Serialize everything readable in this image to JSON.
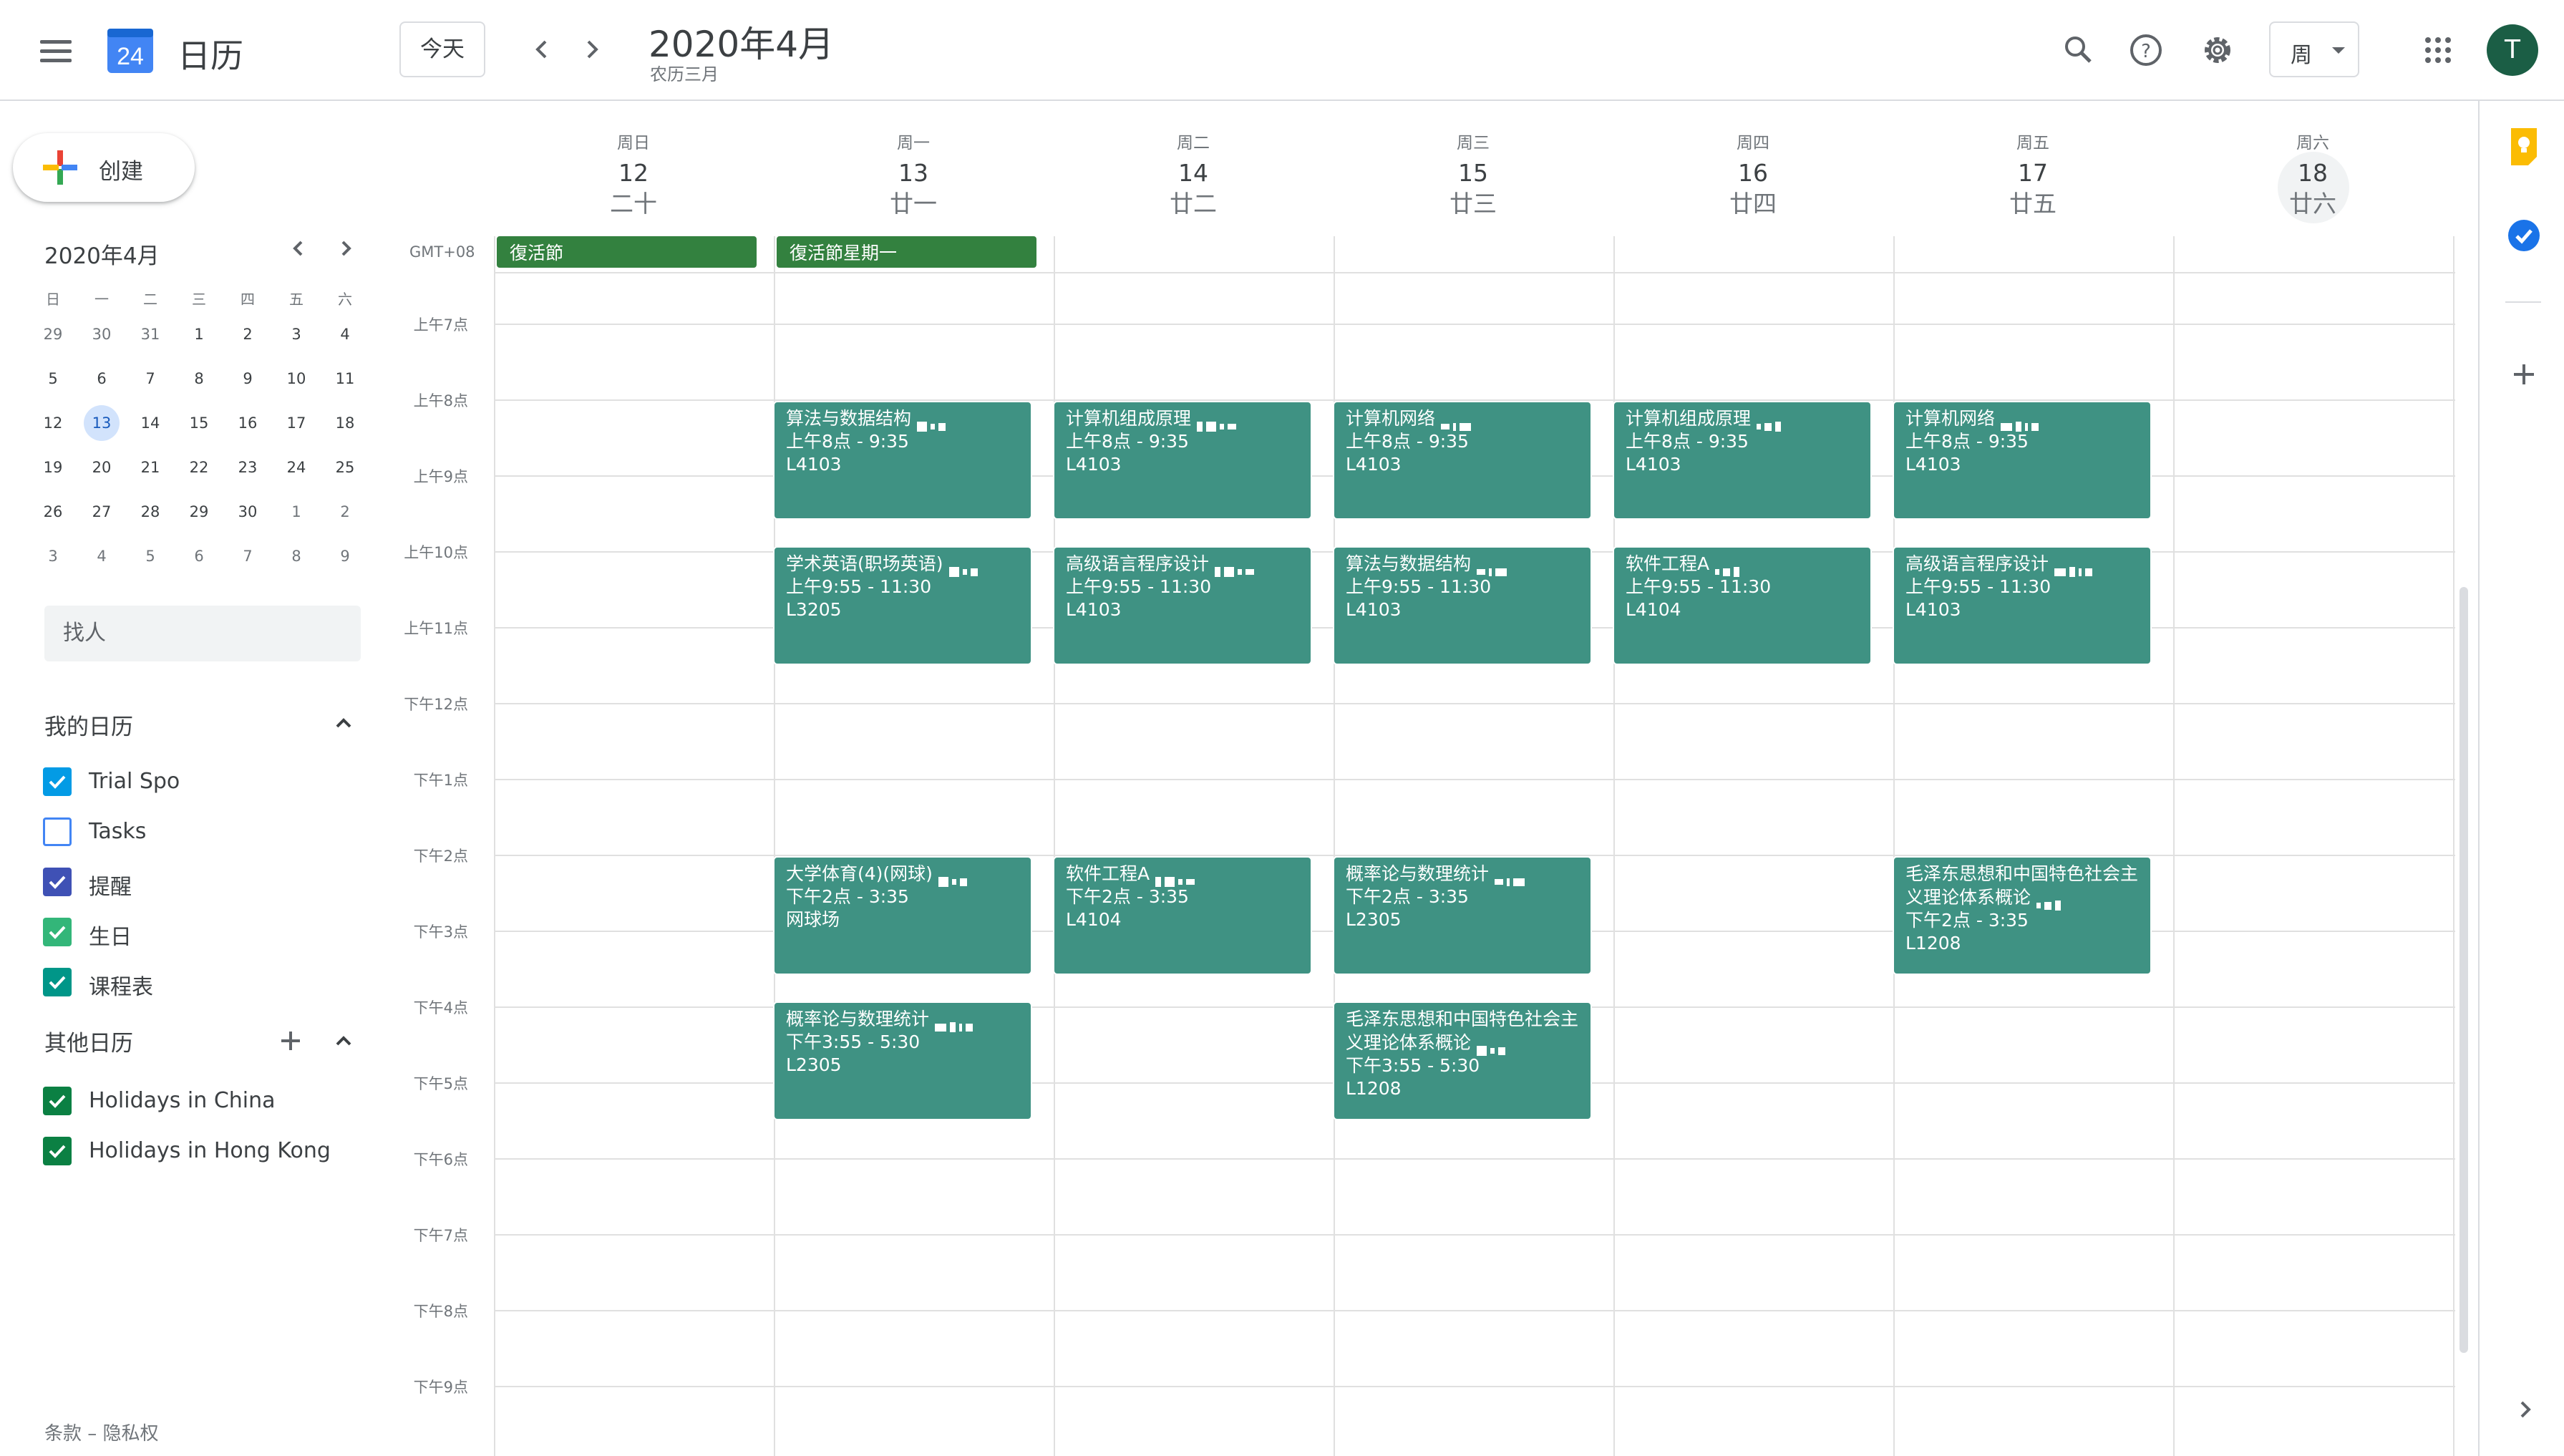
{
  "header": {
    "app_title": "日历",
    "logo_day": "24",
    "today_label": "今天",
    "month_title": "2020年4月",
    "lunar_month": "农历三月",
    "view_label": "周",
    "avatar_letter": "T"
  },
  "sidebar": {
    "create_label": "创建",
    "mini_calendar": {
      "title": "2020年4月",
      "weekdays": [
        "日",
        "一",
        "二",
        "三",
        "四",
        "五",
        "六"
      ],
      "weeks": [
        [
          {
            "d": "29",
            "o": true
          },
          {
            "d": "30",
            "o": true
          },
          {
            "d": "31",
            "o": true
          },
          {
            "d": "1"
          },
          {
            "d": "2"
          },
          {
            "d": "3"
          },
          {
            "d": "4"
          }
        ],
        [
          {
            "d": "5"
          },
          {
            "d": "6"
          },
          {
            "d": "7"
          },
          {
            "d": "8"
          },
          {
            "d": "9"
          },
          {
            "d": "10"
          },
          {
            "d": "11"
          }
        ],
        [
          {
            "d": "12"
          },
          {
            "d": "13",
            "today": true
          },
          {
            "d": "14"
          },
          {
            "d": "15"
          },
          {
            "d": "16"
          },
          {
            "d": "17"
          },
          {
            "d": "18"
          }
        ],
        [
          {
            "d": "19"
          },
          {
            "d": "20"
          },
          {
            "d": "21"
          },
          {
            "d": "22"
          },
          {
            "d": "23"
          },
          {
            "d": "24"
          },
          {
            "d": "25"
          }
        ],
        [
          {
            "d": "26"
          },
          {
            "d": "27"
          },
          {
            "d": "28"
          },
          {
            "d": "29"
          },
          {
            "d": "30"
          },
          {
            "d": "1",
            "o": true
          },
          {
            "d": "2",
            "o": true
          }
        ],
        [
          {
            "d": "3",
            "o": true
          },
          {
            "d": "4",
            "o": true
          },
          {
            "d": "5",
            "o": true
          },
          {
            "d": "6",
            "o": true
          },
          {
            "d": "7",
            "o": true
          },
          {
            "d": "8",
            "o": true
          },
          {
            "d": "9",
            "o": true
          }
        ]
      ]
    },
    "people_search_placeholder": "找人",
    "my_calendars_title": "我的日历",
    "my_calendars": [
      {
        "name": "Trial Spo",
        "color": "#039be5",
        "checked": true
      },
      {
        "name": "Tasks",
        "color": "#4285f4",
        "checked": false
      },
      {
        "name": "提醒",
        "color": "#3f51b5",
        "checked": true
      },
      {
        "name": "生日",
        "color": "#33b679",
        "checked": true
      },
      {
        "name": "课程表",
        "color": "#009688",
        "checked": true
      }
    ],
    "other_calendars_title": "其他日历",
    "other_calendars": [
      {
        "name": "Holidays in China",
        "color": "#0b8043",
        "checked": true
      },
      {
        "name": "Holidays in Hong Kong",
        "color": "#0b8043",
        "checked": true
      }
    ],
    "footer": "条款 – 隐私权"
  },
  "week": {
    "timezone": "GMT+08",
    "days": [
      {
        "dow": "周日",
        "num": "12",
        "lunar": "二十"
      },
      {
        "dow": "周一",
        "num": "13",
        "lunar": "廿一"
      },
      {
        "dow": "周二",
        "num": "14",
        "lunar": "廿二"
      },
      {
        "dow": "周三",
        "num": "15",
        "lunar": "廿三"
      },
      {
        "dow": "周四",
        "num": "16",
        "lunar": "廿四"
      },
      {
        "dow": "周五",
        "num": "17",
        "lunar": "廿五"
      },
      {
        "dow": "周六",
        "num": "18",
        "lunar": "廿六"
      }
    ],
    "hours": [
      "上午7点",
      "上午8点",
      "上午9点",
      "上午10点",
      "上午11点",
      "下午12点",
      "下午1点",
      "下午2点",
      "下午3点",
      "下午4点",
      "下午5点",
      "下午6点",
      "下午7点",
      "下午8点",
      "下午9点"
    ],
    "all_day_events": [
      {
        "day": 0,
        "title": "復活節"
      },
      {
        "day": 1,
        "title": "復活節星期一"
      }
    ],
    "events": [
      {
        "day": 1,
        "start": 8.0,
        "end": 9.583,
        "title": "算法与数据结构",
        "time": "上午8点 - 9:35",
        "room": "L4103"
      },
      {
        "day": 2,
        "start": 8.0,
        "end": 9.583,
        "title": "计算机组成原理",
        "time": "上午8点 - 9:35",
        "room": "L4103"
      },
      {
        "day": 3,
        "start": 8.0,
        "end": 9.583,
        "title": "计算机网络",
        "time": "上午8点 - 9:35",
        "room": "L4103"
      },
      {
        "day": 4,
        "start": 8.0,
        "end": 9.583,
        "title": "计算机组成原理",
        "time": "上午8点 - 9:35",
        "room": "L4103"
      },
      {
        "day": 5,
        "start": 8.0,
        "end": 9.583,
        "title": "计算机网络",
        "time": "上午8点 - 9:35",
        "room": "L4103"
      },
      {
        "day": 1,
        "start": 9.917,
        "end": 11.5,
        "title": "学术英语(职场英语)",
        "time": "上午9:55 - 11:30",
        "room": "L3205"
      },
      {
        "day": 2,
        "start": 9.917,
        "end": 11.5,
        "title": "高级语言程序设计",
        "time": "上午9:55 - 11:30",
        "room": "L4103"
      },
      {
        "day": 3,
        "start": 9.917,
        "end": 11.5,
        "title": "算法与数据结构",
        "time": "上午9:55 - 11:30",
        "room": "L4103"
      },
      {
        "day": 4,
        "start": 9.917,
        "end": 11.5,
        "title": "软件工程A",
        "time": "上午9:55 - 11:30",
        "room": "L4104"
      },
      {
        "day": 5,
        "start": 9.917,
        "end": 11.5,
        "title": "高级语言程序设计",
        "time": "上午9:55 - 11:30",
        "room": "L4103"
      },
      {
        "day": 1,
        "start": 14.0,
        "end": 15.583,
        "title": "大学体育(4)(网球)",
        "time": "下午2点 - 3:35",
        "room": "网球场"
      },
      {
        "day": 2,
        "start": 14.0,
        "end": 15.583,
        "title": "软件工程A",
        "time": "下午2点 - 3:35",
        "room": "L4104"
      },
      {
        "day": 3,
        "start": 14.0,
        "end": 15.583,
        "title": "概率论与数理统计",
        "time": "下午2点 - 3:35",
        "room": "L2305"
      },
      {
        "day": 5,
        "start": 14.0,
        "end": 15.583,
        "title": "毛泽东思想和中国特色社会主义理论体系概论",
        "time": "下午2点 - 3:35",
        "room": "L1208"
      },
      {
        "day": 1,
        "start": 15.917,
        "end": 17.5,
        "title": "概率论与数理统计",
        "time": "下午3:55 - 5:30",
        "room": "L2305"
      },
      {
        "day": 3,
        "start": 15.917,
        "end": 17.5,
        "title": "毛泽东思想和中国特色社会主义理论体系概论",
        "time": "下午3:55 - 5:30",
        "room": "L1208"
      }
    ]
  },
  "colors": {
    "event": "#3f9283",
    "holiday": "#33813f",
    "accent": "#1a73e8"
  }
}
